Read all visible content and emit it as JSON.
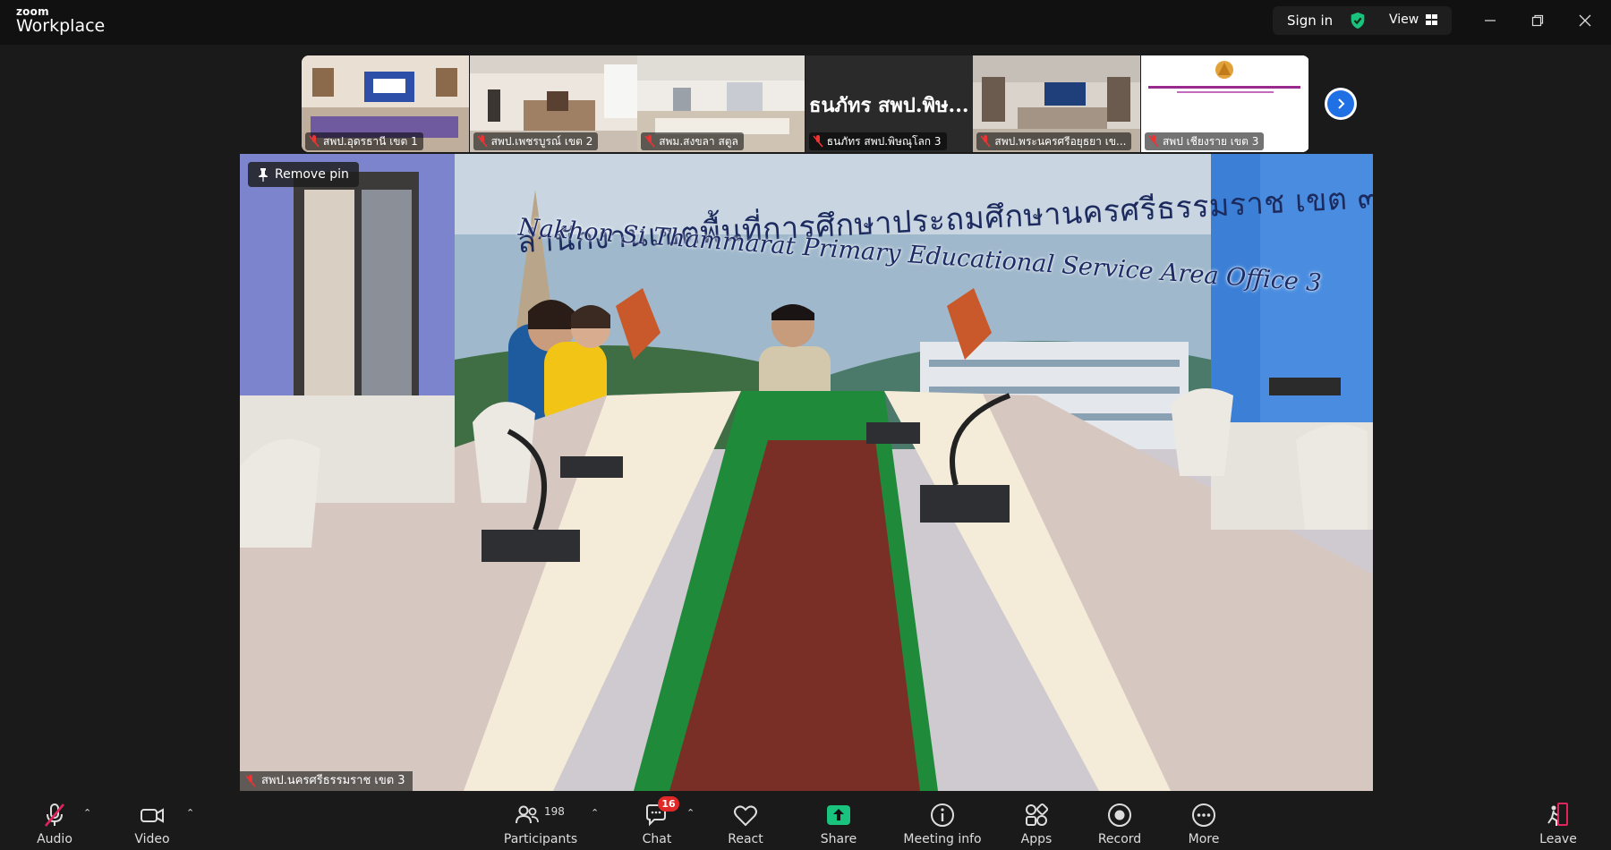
{
  "app": {
    "logo_top": "zoom",
    "logo_bottom": "Workplace",
    "sign_in": "Sign in",
    "view_label": "View"
  },
  "thumbnails": [
    {
      "label": "สพป.อุดรธานี เขต 1",
      "kind": "video"
    },
    {
      "label": "สพป.เพชรบูรณ์ เขต 2",
      "kind": "video"
    },
    {
      "label": "สพม.สงขลา สตูล",
      "kind": "video"
    },
    {
      "label": "ธนภัทร สพป.พิษณุโลก 3",
      "kind": "name",
      "display_name": "ธนภัทร สพป.พิษ..."
    },
    {
      "label": "สพป.พระนครศรีอยุธยา เข...",
      "kind": "video"
    },
    {
      "label": "สพป เชียงราย เขต 3",
      "kind": "slide"
    }
  ],
  "main_video": {
    "remove_pin": "Remove pin",
    "participant_label": "สพป.นครศรีธรรมราช เขต 3",
    "banner_thai": "สำนักงานเขตพื้นที่การศึกษาประถมศึกษานครศรีธรรมราช เขต ๓",
    "banner_english": "Nakhon Si Thammarat Primary Educational Service Area Office 3"
  },
  "toolbar": {
    "audio": "Audio",
    "video": "Video",
    "participants": "Participants",
    "participants_count": "198",
    "chat": "Chat",
    "chat_badge": "16",
    "react": "React",
    "share": "Share",
    "meeting_info": "Meeting info",
    "apps": "Apps",
    "record": "Record",
    "more": "More",
    "leave": "Leave"
  },
  "colors": {
    "background": "#1a1a1a",
    "titlebar": "#111111",
    "share_green": "#19c37d",
    "badge_red": "#e02828",
    "next_blue": "#1f6fe5",
    "leave_red": "#e0245e"
  }
}
